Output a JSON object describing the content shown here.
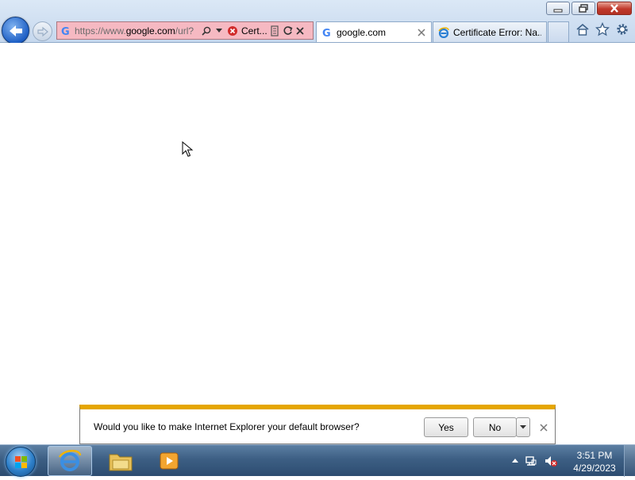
{
  "browser": {
    "address_url": "https://www.google.com/url?",
    "address_url_host": "google.com",
    "address_url_prefix": "https://www.",
    "address_url_suffix": "/url?",
    "cert_error_short": "Cert...",
    "tabs": [
      {
        "label": "google.com",
        "icon": "google-g-icon",
        "active": true
      },
      {
        "label": "Certificate Error: Na...",
        "icon": "ie-icon",
        "active": false
      }
    ]
  },
  "notification": {
    "message": "Would you like to make Internet Explorer your default browser?",
    "yes_label": "Yes",
    "no_label": "No"
  },
  "taskbar": {
    "time": "3:51 PM",
    "date": "4/29/2023"
  },
  "colors": {
    "address_error_bg": "#f6b9c2",
    "notification_accent": "#e5a600",
    "taskbar": "#3d5f84"
  }
}
